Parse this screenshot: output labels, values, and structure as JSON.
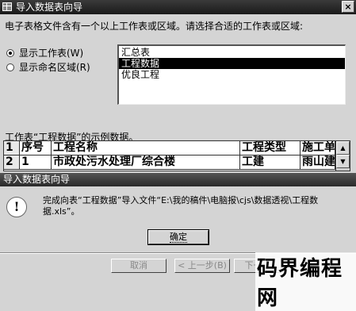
{
  "wizard": {
    "title": "导入数据表向导",
    "intro": "电子表格文件含有一个以上工作表或区域。请选择合适的工作表或区域:",
    "radio_sheets": "显示工作表(W)",
    "radio_ranges": "显示命名区域(R)",
    "sheets": [
      "汇总表",
      "工程数据",
      "优良工程"
    ],
    "selected_index": 1,
    "sample_label": "工作表“工程数据”的示例数据。",
    "sample": {
      "rows": [
        {
          "num": "1",
          "cells": [
            "序号",
            "工程名称",
            "工程类型",
            "施工单"
          ]
        },
        {
          "num": "2",
          "cells": [
            "1",
            "市政处污水处理厂综合楼",
            "工建",
            "雨山建"
          ]
        }
      ]
    },
    "buttons": {
      "cancel": "取消",
      "prev": "< 上一步(B)",
      "next": "下一步"
    }
  },
  "message": {
    "title": "导入数据表向导",
    "icon": "info-icon",
    "text": "完成向表“工程数据”导入文件“E:\\我的稿件\\电脑报\\cjs\\数据透视\\工程数据.xls”。",
    "ok": "确定"
  },
  "watermark": "码界编程网"
}
